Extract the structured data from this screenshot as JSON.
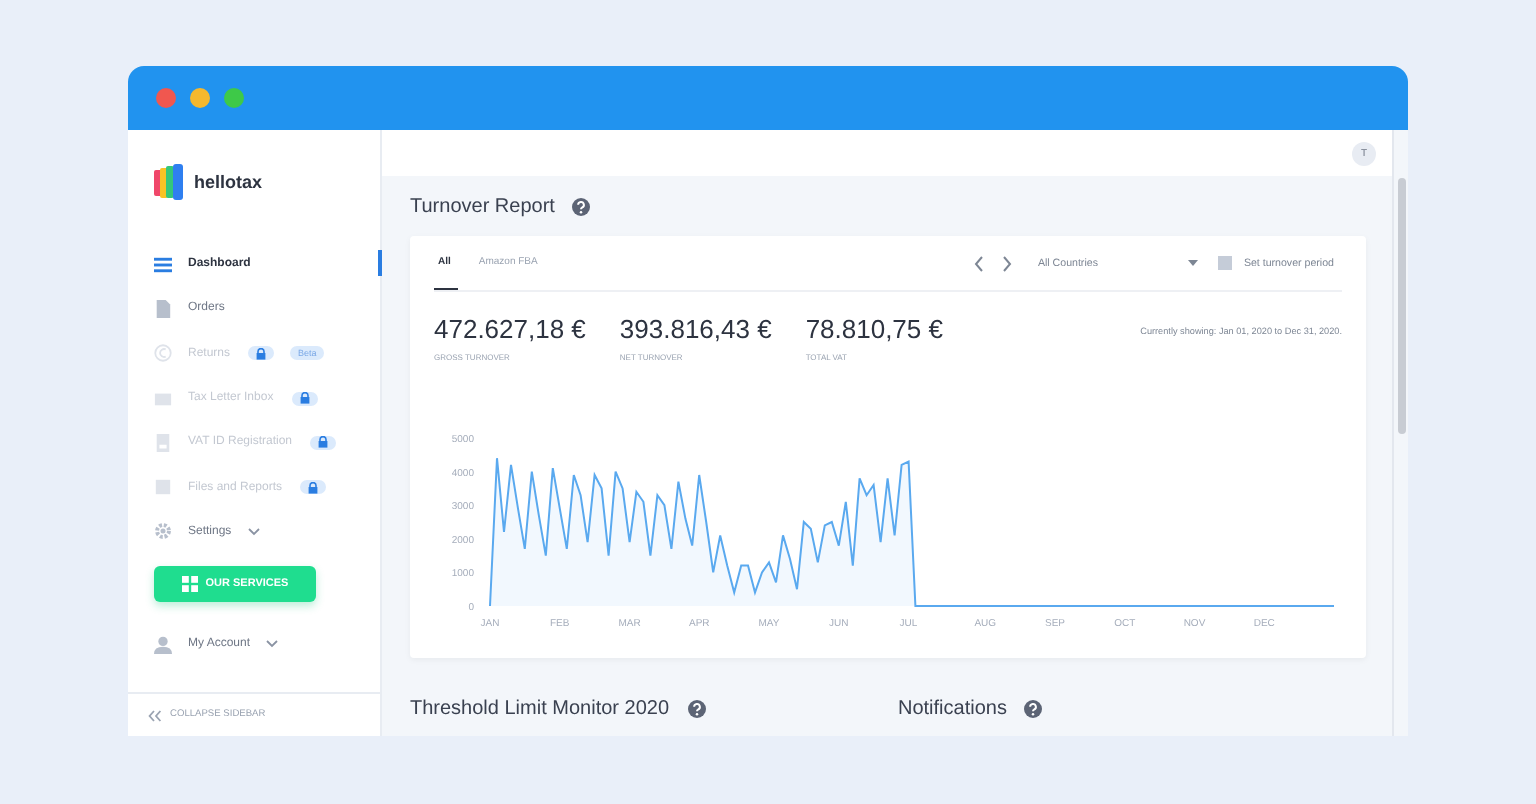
{
  "window": {
    "controls": [
      {
        "color": "#f0574f"
      },
      {
        "color": "#f5b82e"
      },
      {
        "color": "#3ec948"
      }
    ]
  },
  "sidebar": {
    "logo": "hellotax",
    "items": [
      {
        "label": "Dashboard",
        "selected": true,
        "disabled": false,
        "locked": false,
        "expandable": false
      },
      {
        "label": "Orders",
        "selected": false,
        "disabled": false,
        "locked": false,
        "expandable": false
      },
      {
        "label": "Returns",
        "selected": false,
        "disabled": true,
        "locked": true,
        "badge": "Beta",
        "expandable": false
      },
      {
        "label": "Tax Letter Inbox",
        "selected": false,
        "disabled": true,
        "locked": true,
        "expandable": false
      },
      {
        "label": "VAT ID Registration",
        "selected": false,
        "disabled": true,
        "locked": true,
        "expandable": false
      },
      {
        "label": "Files and Reports",
        "selected": false,
        "disabled": true,
        "locked": true,
        "expandable": false
      },
      {
        "label": "Settings",
        "selected": false,
        "disabled": false,
        "locked": false,
        "expandable": true
      }
    ],
    "services_button": "OUR SERVICES",
    "account": {
      "label": "My Account",
      "expandable": true
    },
    "collapse": "COLLAPSE SIDEBAR"
  },
  "topbar": {
    "avatar": "T"
  },
  "turnover": {
    "title": "Turnover Report",
    "tabs": [
      {
        "label": "All",
        "selected": true
      },
      {
        "label": "Amazon FBA",
        "selected": false
      }
    ],
    "country_select": "All Countries",
    "period_button": "Set turnover period",
    "totals": [
      {
        "value": "472.627,18 €",
        "label": "GROSS TURNOVER"
      },
      {
        "value": "393.816,43 €",
        "label": "NET TURNOVER"
      },
      {
        "value": "78.810,75 €",
        "label": "TOTAL VAT"
      }
    ],
    "date_range": "Currently showing: Jan 01, 2020 to Dec 31, 2020.",
    "chart_data": {
      "type": "area",
      "categories": [
        "JAN",
        null,
        null,
        null,
        null,
        null,
        null,
        null,
        null,
        null,
        "FEB",
        null,
        null,
        null,
        null,
        null,
        null,
        null,
        null,
        null,
        "MAR",
        null,
        null,
        null,
        null,
        null,
        null,
        null,
        null,
        null,
        "APR",
        null,
        null,
        null,
        null,
        null,
        null,
        null,
        null,
        null,
        "MAY",
        null,
        null,
        null,
        null,
        null,
        null,
        null,
        null,
        null,
        "JUN",
        null,
        null,
        null,
        null,
        null,
        null,
        null,
        null,
        null,
        "JUL",
        null,
        null,
        null,
        null,
        null,
        null,
        null,
        null,
        null,
        null,
        "AUG",
        null,
        null,
        null,
        null,
        null,
        null,
        null,
        null,
        null,
        "SEP",
        null,
        null,
        null,
        null,
        null,
        null,
        null,
        null,
        null,
        "OCT",
        null,
        null,
        null,
        null,
        null,
        null,
        null,
        null,
        null,
        "NOV",
        null,
        null,
        null,
        null,
        null,
        null,
        null,
        null,
        null,
        "DEC",
        null,
        null,
        null,
        null,
        null,
        null,
        null,
        null,
        null,
        null
      ],
      "series": [
        {
          "color": "#5aa9ef",
          "values": [
            0,
            4400,
            2200,
            4200,
            2900,
            1700,
            4000,
            2700,
            1500,
            4100,
            2900,
            1700,
            3900,
            3300,
            1900,
            3900,
            3500,
            1500,
            4000,
            3500,
            1900,
            3400,
            3100,
            1500,
            3300,
            3000,
            1700,
            3700,
            2600,
            1800,
            3900,
            2500,
            1000,
            2100,
            1200,
            400,
            1200,
            1200,
            400,
            1000,
            1300,
            700,
            2100,
            1400,
            500,
            2500,
            2300,
            1300,
            2400,
            2500,
            1800,
            3100,
            1200,
            3800,
            3300,
            3600,
            1900,
            3800,
            2100,
            4200,
            4300,
            0,
            0,
            0,
            0,
            0,
            0,
            0,
            0,
            0,
            0,
            0,
            0,
            0,
            0,
            0,
            0,
            0,
            0,
            0,
            0,
            0,
            0,
            0,
            0,
            0,
            0,
            0,
            0,
            0,
            0,
            0,
            0,
            0,
            0,
            0,
            0,
            0,
            0,
            0,
            0,
            0,
            0,
            0,
            0,
            0,
            0,
            0,
            0,
            0,
            0,
            0,
            0,
            0,
            0,
            0,
            0,
            0,
            0,
            0,
            0,
            0
          ]
        }
      ],
      "ylim": [
        0,
        5000
      ],
      "yticks": [
        0,
        1000,
        2000,
        3000,
        4000,
        5000
      ]
    }
  },
  "sections": [
    {
      "title": "Threshold Limit Monitor 2020"
    },
    {
      "title": "Notifications"
    }
  ]
}
